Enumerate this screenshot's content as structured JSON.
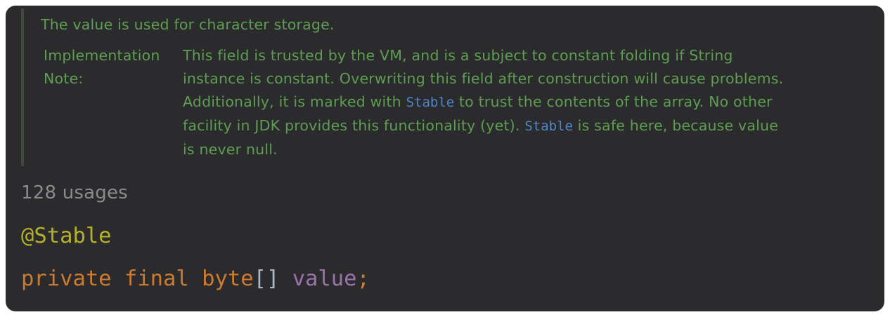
{
  "doc": {
    "summary": "The value is used for character storage.",
    "impl_term_line1": "Implementation",
    "impl_term_line2": "Note:",
    "line1": "This field is trusted by the VM, and is a subject to constant folding if String",
    "line2": "instance is constant. Overwriting this field after construction will cause problems.",
    "line3_before": "Additionally, it is marked with ",
    "line3_link": "Stable",
    "line3_after": " to trust the contents of the array. No other",
    "line4_before": "facility in JDK provides this functionality (yet). ",
    "line4_link": "Stable",
    "line4_after": " is safe here, because value",
    "line5": "is never null."
  },
  "usages": "128 usages",
  "code": {
    "annotation": "@Stable",
    "kw_private": "private",
    "kw_final": "final",
    "type": "byte",
    "brackets": "[]",
    "field": "value",
    "semicolon": ";"
  },
  "colors": {
    "background": "#2b2b2d",
    "doc_text": "#5e9e52",
    "doc_link": "#4f86c8",
    "usages": "#8a8a8a",
    "annotation": "#b5b22a",
    "keyword": "#cc7a30",
    "field": "#9a72ad"
  }
}
